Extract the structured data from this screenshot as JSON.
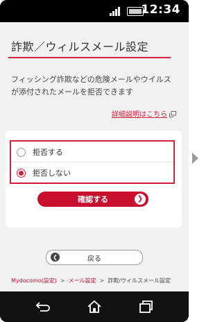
{
  "status_bar": {
    "time": "12:34",
    "icons": [
      "signal-icon",
      "battery-icon"
    ]
  },
  "page": {
    "title": "詐欺／ウィルスメール設定",
    "description": "フィッシング詐欺などの危険メールやウイルスが添付されたメールを拒否できます",
    "detail_link": "詳細説明はこちら"
  },
  "options": [
    {
      "label": "拒否する",
      "checked": false
    },
    {
      "label": "拒否しない",
      "checked": true
    }
  ],
  "buttons": {
    "confirm": "確認する",
    "back": "戻る"
  },
  "breadcrumb": {
    "items": [
      "Mydocomo(設定)",
      "メール設定",
      "詐欺/ウィルスメール設定"
    ]
  },
  "nav_bar": {
    "icons": [
      "back-nav-icon",
      "home-nav-icon",
      "recent-apps-icon"
    ]
  },
  "colors": {
    "accent": "#d41f3b",
    "button": "#c8102e"
  }
}
